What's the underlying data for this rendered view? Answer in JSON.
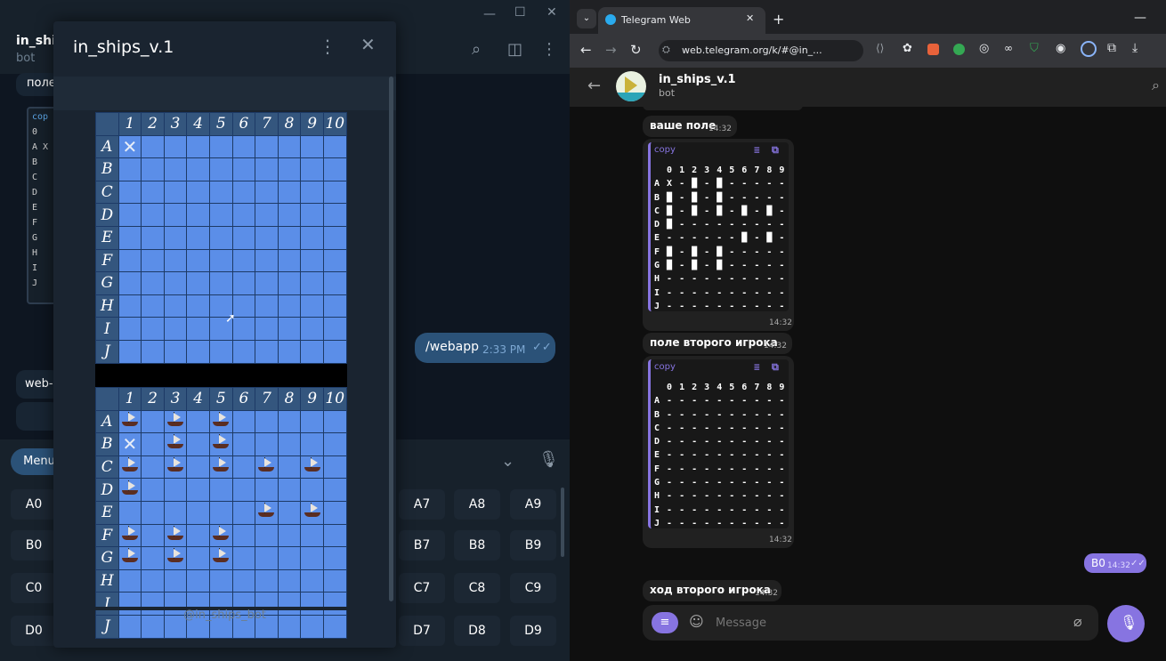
{
  "desktop": {
    "title": "in_ship",
    "subtitle": "bot",
    "partial_text_top": "поле",
    "snippet_header": "cop",
    "snippet_rows": [
      "0",
      "A X",
      "B",
      "C",
      "D",
      "E",
      "F",
      "G",
      "H",
      "I",
      "J"
    ],
    "out_message": "/webapp",
    "out_time": "2:33 PM",
    "in_partial": "web-",
    "menu_label": "Menu",
    "left_keys": [
      "A0",
      "B0",
      "C0",
      "D0"
    ],
    "right_keys": [
      [
        "A7",
        "A8",
        "A9"
      ],
      [
        "B7",
        "B8",
        "B9"
      ],
      [
        "C7",
        "C8",
        "C9"
      ],
      [
        "D7",
        "D8",
        "D9"
      ]
    ]
  },
  "popup": {
    "title": "in_ships_v.1",
    "footer": "@in_ships_bot",
    "col_headers": [
      "1",
      "2",
      "3",
      "4",
      "5",
      "6",
      "7",
      "8",
      "9",
      "10"
    ],
    "row_headers": [
      "A",
      "B",
      "C",
      "D",
      "E",
      "F",
      "G",
      "H",
      "I",
      "J"
    ],
    "top_board": {
      "A1": "miss"
    },
    "bottom_board": {
      "A1": "ship",
      "A3": "ship",
      "A5": "ship",
      "B1": "miss",
      "B3": "ship",
      "B5": "ship",
      "C1": "ship",
      "C3": "ship",
      "C5": "ship",
      "C7": "ship",
      "C9": "ship",
      "D1": "ship",
      "E7": "ship",
      "E9": "ship",
      "F1": "ship",
      "F3": "ship",
      "F5": "ship",
      "G1": "ship",
      "G3": "ship",
      "G5": "ship"
    }
  },
  "browser": {
    "tab_title": "Telegram Web",
    "url": "web.telegram.org/k/#@in_...",
    "chat_title": "in_ships_v.1",
    "chat_subtitle": "bot",
    "messages": [
      {
        "text": "ваше поле",
        "time": "14:32"
      },
      {
        "copy": "copy",
        "header": "  0 1 2 3 4 5 6 7 8 9",
        "rows": [
          "A X - █ - █ - - - - -",
          "B █ - █ - █ - - - - -",
          "C █ - █ - █ - █ - █ -",
          "D █ - - - - - - - - -",
          "E - - - - - - █ - █ -",
          "F █ - █ - █ - - - - -",
          "G █ - █ - █ - - - - -",
          "H - - - - - - - - - -",
          "I - - - - - - - - - -",
          "J - - - - - - - - - -"
        ],
        "time": "14:32"
      },
      {
        "text": "поле второго игрока",
        "time": "14:32"
      },
      {
        "copy": "copy",
        "header": "  0 1 2 3 4 5 6 7 8 9",
        "rows": [
          "A - - - - - - - - - -",
          "B - - - - - - - - - -",
          "C - - - - - - - - - -",
          "D - - - - - - - - - -",
          "E - - - - - - - - - -",
          "F - - - - - - - - - -",
          "G - - - - - - - - - -",
          "H - - - - - - - - - -",
          "I - - - - - - - - - -",
          "J - - - - - - - - - -"
        ],
        "time": "14:32"
      },
      {
        "out": "B0",
        "time": "14:32"
      },
      {
        "text": "ход второго игрока",
        "time": "14:32"
      }
    ],
    "message_placeholder": "Message"
  },
  "colors": {
    "accent": "#8774e1",
    "tg_desktop_blue": "#2b5278",
    "cell_blue": "#5b8ee8"
  }
}
